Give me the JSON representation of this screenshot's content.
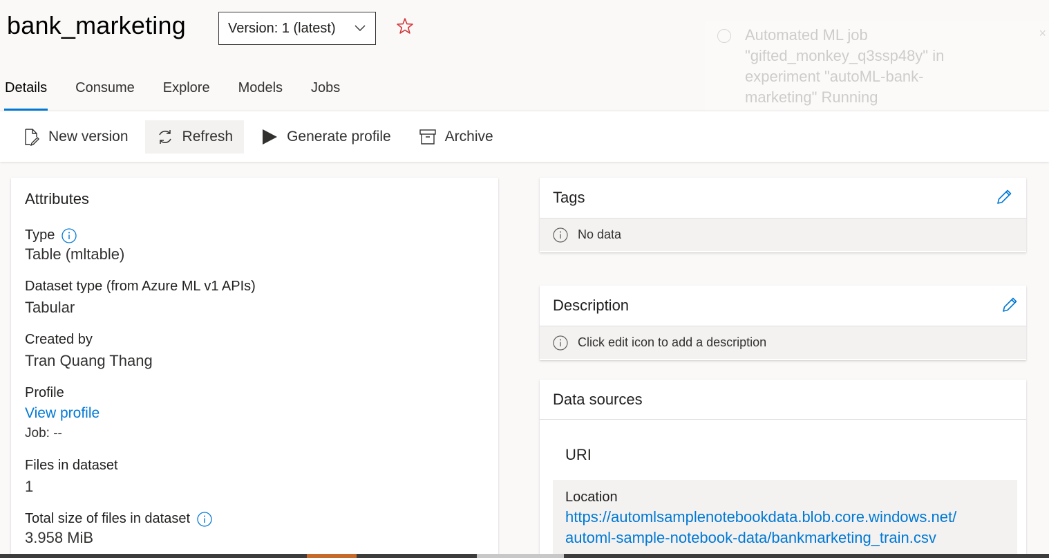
{
  "header": {
    "title": "bank_marketing",
    "version_label": "Version: 1 (latest)"
  },
  "tabs": [
    {
      "label": "Details"
    },
    {
      "label": "Consume"
    },
    {
      "label": "Explore"
    },
    {
      "label": "Models"
    },
    {
      "label": "Jobs"
    }
  ],
  "notification": {
    "text": "Automated ML job \"gifted_monkey_q3ssp48y\" in experiment \"autoML-bank-marketing\" Running",
    "close": "×"
  },
  "toolbar": {
    "new_version": "New version",
    "refresh": "Refresh",
    "generate_profile": "Generate profile",
    "archive": "Archive"
  },
  "attributes": {
    "title": "Attributes",
    "type_label": "Type",
    "type_value": "Table (mltable)",
    "dataset_type_label": "Dataset type (from Azure ML v1 APIs)",
    "dataset_type_value": "Tabular",
    "created_by_label": "Created by",
    "created_by_value": "Tran Quang Thang",
    "profile_label": "Profile",
    "profile_link": "View profile",
    "profile_job": "Job: --",
    "files_label": "Files in dataset",
    "files_value": "1",
    "size_label": "Total size of files in dataset",
    "size_value": "3.958 MiB"
  },
  "tags": {
    "title": "Tags",
    "empty": "No data"
  },
  "description": {
    "title": "Description",
    "empty": "Click edit icon to add a description"
  },
  "data_sources": {
    "title": "Data sources",
    "uri_label": "URI",
    "location_label": "Location",
    "location_line1": "https://automlsamplenotebookdata.blob.core.windows.net/",
    "location_line2": "automl-sample-notebook-data/bankmarketing_train.csv"
  },
  "colors": {
    "accent": "#0078d4",
    "star": "#d13438"
  }
}
